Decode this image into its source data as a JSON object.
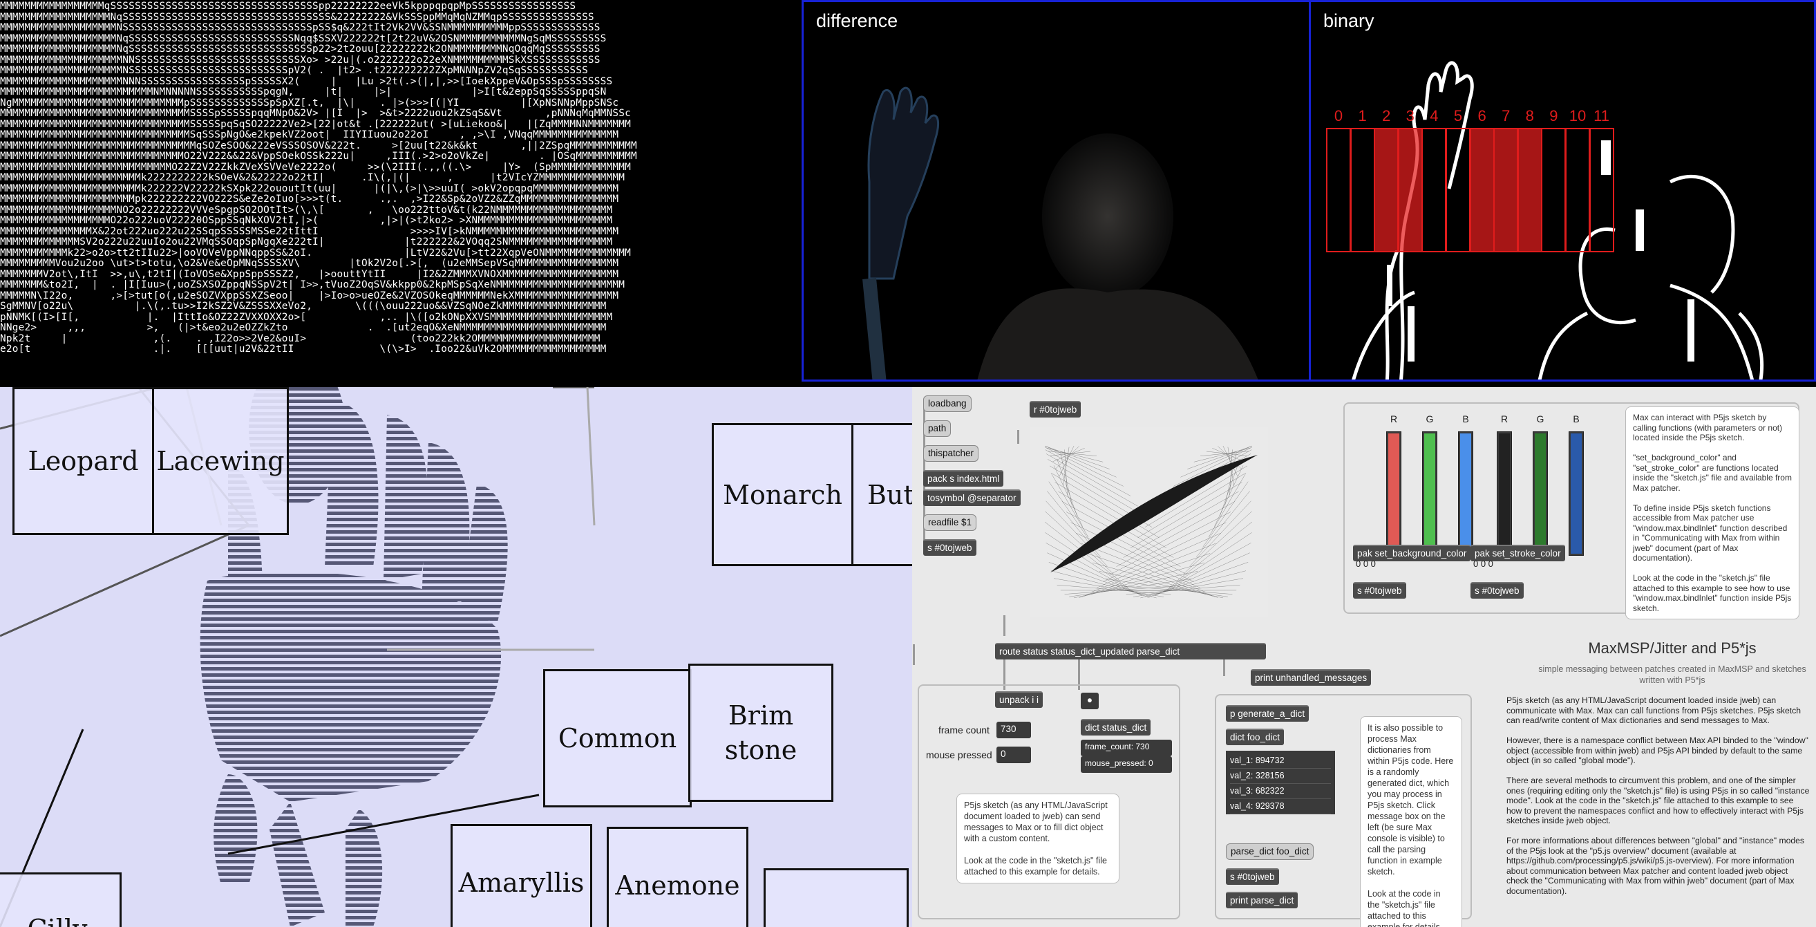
{
  "ascii": {
    "lines": [
      "MMMMMMMMMMMMMMMMMqSSSSSSSSSSSSSSSSSSSSSSSSSSSSSSSSSSpp22222222eeVk5kpppqpqpMpSSSSSSSSSSSSSSSSS",
      "MMMMMMMMMMMMMMMMMMNqSSSSSSSSSSSSSSSSSSSSSSSSSSSSSSSSSS&22222222&VkSSSppMMqMqNZMMqpSSSSSSSSSSSSSSS",
      "MMMMMMMMMMMMMMMMMMMNSSSSSSSSSSSSSSSSSSSSSSSSSSSSSSSpSS$q&222tIt2Vk2VV&SSNMMMMMMMMMMppSSSSSSSSSSSSS",
      "MMMMMMMMMMMMMMMMMMMNqSSSSSSSSSSSSSSSSSSSSSSSSSSSNqq$SSXV222222t[2t22uV&2OSNMMMMMMMMMMNgSqMSSSSSSSSS",
      "MMMMMMMMMMMMMMMMMMMNqSSSSSSSSSSSSSSSSSSSSSSSSSSSSSSp22>2t2ouu[22222222k2ONMMMMMMMMNqOqqMqSSSSSSSSS",
      "MMMMMMMMMMMMMMMMMMMMNNSSSSSSSSSSSSSSSSSSSSSSSSSSSXo> >22u|(.o2222222o22eXNMMMMMMMMMSkXSSSSSSSSSSSS",
      "MMMMMMMMMMMMMMMMMMMMNSSSSSSSSSSSSSSSSSSSSSSSSSSpV2( .  |t2> .t222222222ZXpMNNNpZV2qSqSSSSSSSSSSS",
      "MMMMMMMMMMMMMMMMMMMMNNNSSSSSSSSSSSSSSSSSpSSSSSX2(     |   |Lu >2t(.>(|,|,>>[IoekXppeV&OpSSSpSSSSSSSS",
      "MMMMMMMMMMMMMMMMMMMMMMMMMNMNNNNNSSSSSSSSSSSpqgN,     |t|     |>|             |>I[t&2eppSqSSSSSppqSN",
      "NgMMMMMMMMMMMMMMMMMMMMMMMMMMMMpSSSSSSSSSSSSSpSpXZ[.t,  |\\|    . |>(>>>[(|YI          |[XpNSNNpMppSNSc",
      "MMMMMMMMMMMMMMMMMMMMMMMMMMMMMMMSSSSpSSSSSpqqMNpO&2V> |[I  |>  >&t>2222uou2kZSqS&Vt       ,pNNNqMqMMNSSc",
      "MMMMMMMMMMMMMMMMMMMMMMMMMMMMMMMSSSSSpqSqSO22222Ve2>[22|ot&t .[222222ut( >[uLiekoo&|   |[ZqMMMMNNMMMMMMM",
      "MMMMMMMMMMMMMMMMMMMMMMMMMMMMMMMSqSSSpNgO&e2kpekVZ2oot|  IIYIIuou2o22oI     , ,>\\I ,VNqqMMMMMMMMMMMMMM",
      "MMMMMMMMMMMMMMMMMMMMMMMMMMMMMMMMqSOZeSOO&222eVSSSOSOV&222t.     >[2uu[t22&k&kt       ,||2ZSpqMMMMMMMMMMM",
      "MMMMMMMMMMMMMMMMMMMMMMMMMMMMMMO22V222&&22&VppSOekOSSk222u|     ,III(.>2>o2oVkZe|        . |OSqMMMMMMMMMM",
      "MMMMMMMMMMMMMMMMMMMMMMMMMMMMO22Z2V22ZkkZVeXSVVeVe2222o(     >>(\\2III(.,,((.\\>     |Y>  (SpMMMMMMMMMMMMM",
      "MMMMMMMMMMMMMMMMMMMMMMMk2222222222kSOeV&2&22222o22tI|      .I\\(,|(|      ,      |t2VIcYZMMMMMMMMMMMMMM",
      "MMMMMMMMMMMMMMMMMMMMMMMk222222V22222kSXpk222ououtIt(uu|      |(|\\,(>|\\>>uuI( >okV2opqpqMMMMMMMMMMMMMM",
      "MMMMMMMMMMMMMMMMMMMMMMpk222222222VO222S&eZe2oIuo[>>>t(t.      .,.  ,>I22&Sp&2oVZ2&ZZqMMMMMMMMMMMMMMMM",
      "MMMMMMMMMMMMMMMMMMMNO2o22222222VVVeSpgpSO2OOtIt>(\\,\\[       ,   \\oo222ttoV&t(k22NMMMMMMMMMMMMMMMMMMM",
      "MMMMMMMMMMMMMMMMMMO22o222uoV22220OSppSSqNkXOV2tI,|>(          ,|>|(>t2ko2> >XNMMMMMMMMMMMMMMMMMMMMMM",
      "MMMMMMMMMMMMMMMX&22ot222uo222u22SSqpSSSSSMSSe22tIttI               >>>>IV[>kNMMMMMMMMMMMMMMMMMMMMMMMM",
      "MMMMMMMMMMMMMSV2o222u22uuIo2ou22VMqSSOqpSpNgqXe222tI|             |t222222&2VOqq2SNMMMMMMMMMMMMMMMMM",
      "MMMMMMMMMMMk22>o2o>tt2tIIu22>|ooVOVeVppNNqppSS&2oI.               |LtV22&2Vu[>tt22XqpVeONMMMMMMMMMMMMMM",
      "MMMMMMMMMVou2u2oo \\ut>t>totu,\\o2&Ve&eOpMNqSSSSXV\\        |tOk2V2o[.>[,  (u2eMMSepVSqMMMMMMMMMMMMMMMMM",
      "MMMMMMMV2ot\\,ItI  >>,u\\,t2tI|(IoVOSe&XppSppSSSZ2,   |>oouttYtII     |I2&2ZMMMXVNOXMMMMMMMMMMMMMMMMMMM",
      "MMMMMMM&to2I,  |  . |I[Iuu>(,uoZSXSOZppqNSSpV2t| I>>,tVuoZ2OqSV&kkpp0&2kpMSpSqXeNMMMMMMMMMMMMMMMMMMMMM",
      "MMMMMN\\I22o,      ,>[>tut[o(,u2eSOZVXppSSXZSeoo|    |>Io>o>ueOZe&2VZOSOkeqMMMMMMNekXMMMMMMMMMMMMMMMMM",
      "SgMMNV[o22u\\          |.\\(,.tu>>I2kSZ2V&ZSSSXXeVo2,       \\(((\\ouu222uo&&VZSqNOeZkMMMMMMMMMMMMMMMMM",
      "pNNMK[(I>[I[,           |.  |IttIo&OZ22ZVXXOXX2o>[            ,.. |\\([o2kONpXXVSMMMMMMMMMMMMMMMMMMMM",
      "NNge2>     ,,,          >,   (|>t&eo2u2eOZZkZto             .  .[ut2eqO&XeNMMMMMMMMMMMMMMMMMMMMMMMM",
      "Npk2t     |              ,(.    . ,I22o>>2Ve2&ouI>                 (too222kk2OMMMMMMMMMMMMMMMMMMMM",
      "e2o[t                    .|.    [[[uut|u2V&22tII              \\(\\>I>  .Ioo22&uVk2OMMMMMMMMMMMMMMMMM"
    ]
  },
  "video": {
    "difference_label": "difference",
    "binary_label": "binary",
    "zones": [
      {
        "label": "0",
        "active": false
      },
      {
        "label": "1",
        "active": false
      },
      {
        "label": "2",
        "active": true
      },
      {
        "label": "3",
        "active": true
      },
      {
        "label": "4",
        "active": false
      },
      {
        "label": "5",
        "active": false
      },
      {
        "label": "6",
        "active": true
      },
      {
        "label": "7",
        "active": true
      },
      {
        "label": "8",
        "active": true
      },
      {
        "label": "9",
        "active": false
      },
      {
        "label": "10",
        "active": false
      },
      {
        "label": "11",
        "active": false
      }
    ],
    "accent_color": "#1722d6",
    "zone_color": "#e01c1c"
  },
  "butterflies": {
    "background": "#dcdcf7",
    "boxes": [
      "Leopard",
      "Lacewing",
      "Monarch",
      "But",
      "Common",
      "Brim stone",
      "Amaryllis",
      "Anemone",
      "Cilly"
    ]
  },
  "maxpatch": {
    "objects": {
      "loadbang": "loadbang",
      "path": "path",
      "thispatcher": "thispatcher",
      "pack": "pack s index.html",
      "tosymbol": "tosymbol @separator",
      "readfile": "readfile $1",
      "s_jweb": "s #0tojweb",
      "r_jweb": "r #0tojweb",
      "route": "route status status_dict_updated parse_dict",
      "print_unhandled": "print unhandled_messages",
      "unpack": "unpack i i",
      "dict_status": "dict status_dict",
      "pak_bg": "pak set_background_color",
      "pak_stroke": "pak set_stroke_color",
      "pak_bg_vals": "0 0 0",
      "pak_stroke_vals": "0 0 0",
      "s_jweb_bg": "s #0tojweb",
      "s_jweb_stroke": "s #0tojweb",
      "p_generate": "p generate_a_dict",
      "dict_foo": "dict foo_dict",
      "parse_dict": "parse_dict foo_dict",
      "s_jweb_dict": "s #0tojweb",
      "print_parse": "print parse_dict"
    },
    "frame_count_label": "frame count",
    "frame_count_value": "730",
    "mouse_pressed_label": "mouse pressed",
    "mouse_pressed_value": "0",
    "status_frame_count": "frame_count: 730",
    "status_mouse_pressed": "mouse_pressed: 0",
    "dict_values": [
      "val_1: 894732",
      "val_2: 328156",
      "val_3: 682322",
      "val_4: 929378"
    ],
    "slider_labels": [
      "R",
      "G",
      "B",
      "R",
      "G",
      "B"
    ],
    "slider_colors": [
      "#e05a55",
      "#4fbf4f",
      "#4a8fea",
      "#222222",
      "#2d7a2d",
      "#2a5aaa"
    ],
    "bubble_top": "Max can interact with P5js sketch by calling functions (with parameters or not) located inside the P5js sketch.\n\n\"set_background_color\" and \"set_stroke_color\" are functions located inside the \"sketch.js\" file and available from Max patcher.\n\nTo define inside P5js sketch functions accessible from Max patcher use \"window.max.bindInlet\" function described in \"Communicating with Max from within jweb\" document (part of Max documentation).\n\nLook at the code in the \"sketch.js\" file attached to this example to see how to use \"window.max.bindInlet\" function inside P5js sketch.",
    "bubble_status": "P5js sketch (as any HTML/JavaScript document loaded to jweb) can send messages to Max or to fill dict object with a custom content.\n\nLook at the code in the \"sketch.js\" file attached to this example for details.",
    "bubble_dict": "It is also possible to process Max dictionaries from within P5js code. Here is a randomly generated dict, which you may process in P5js sketch. Click message box on the left (be sure Max console is visible) to call the parsing function in example sketch.\n\nLook at the code in the \"sketch.js\" file attached to this example for details.",
    "title": "MaxMSP/Jitter and P5*js",
    "subtitle": "simple messaging between patches created in MaxMSP and sketches written with P5*js",
    "body": "P5js sketch (as any HTML/JavaScript document loaded inside jweb) can communicate with Max. Max can call functions from P5js sketches. P5js sketch can read/write content of Max dictionaries and send messages to Max.\n\nHowever, there is a namespace conflict between Max API binded to the \"window\" object (accessible from within jweb) and P5js API binded by default to the same object (in so called \"global mode\").\n\nThere are several methods to circumvent this problem, and one of the simpler ones (requiring editing only the \"sketch.js\" file) is using P5js in so called \"instance mode\". Look at the code in the \"sketch.js\" file attached to this example to see how to prevent the namespaces conflict and how to effectively interact with P5js sketches inside jweb object.\n\nFor more informations about differences between \"global\" and \"instance\" modes of the P5js look at the \"p5.js overview\" document (available at https://github.com/processing/p5.js/wiki/p5.js-overview). For more information about communication between Max patcher and content loaded jweb object check the \"Communicating with Max from within jweb\" document (part of Max documentation)."
  }
}
